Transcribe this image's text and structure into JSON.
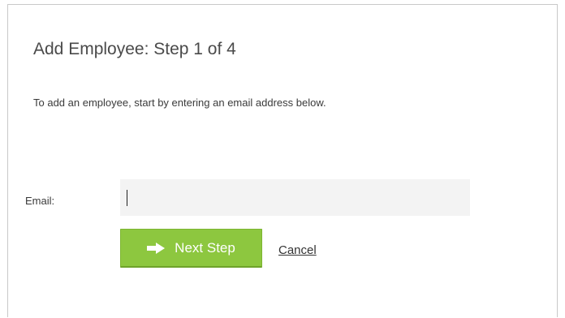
{
  "dialog": {
    "title": "Add Employee: Step 1 of 4",
    "intro": "To add an employee, start by entering an email address below."
  },
  "form": {
    "email_label": "Email:",
    "email_value": "",
    "email_placeholder": ""
  },
  "actions": {
    "next_label": "Next Step",
    "cancel_label": "Cancel"
  },
  "icons": {
    "next": "arrow-right-icon"
  },
  "colors": {
    "primary_button": "#8dc73f",
    "field_background": "#f3f3f3",
    "border": "#c9c9c9"
  }
}
